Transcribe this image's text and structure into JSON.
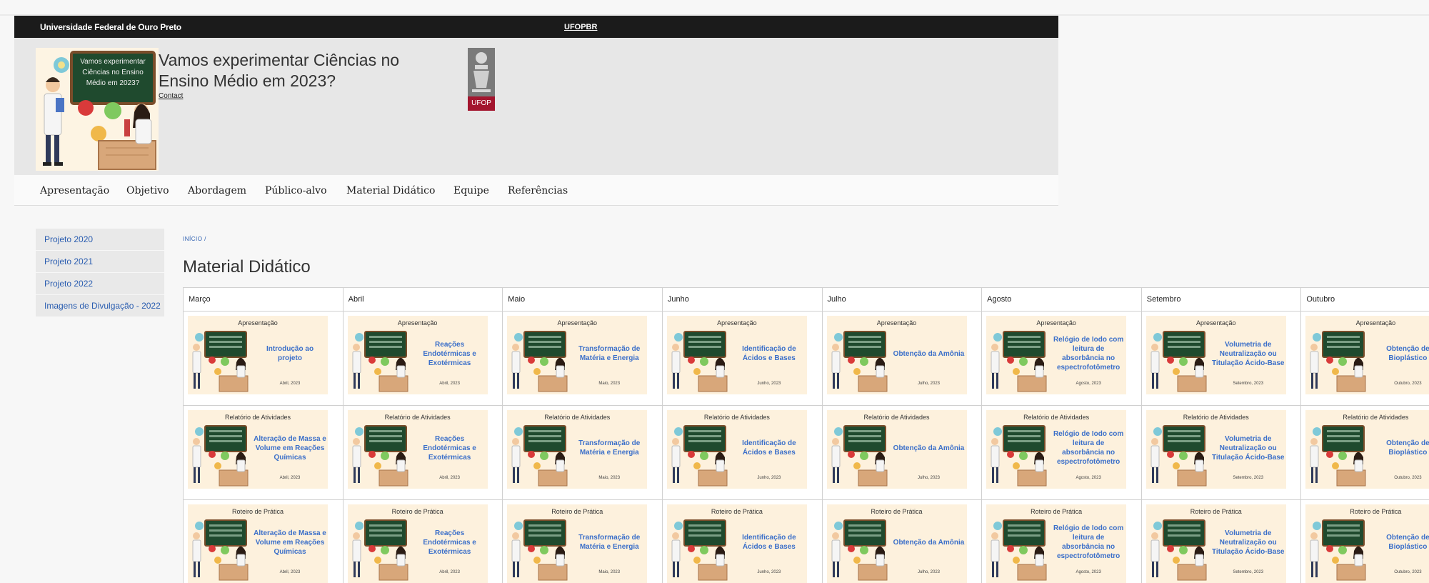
{
  "topbar": {
    "university": "Universidade Federal de Ouro Preto",
    "sigla": "UFOPBR"
  },
  "header": {
    "logo_text": "Vamos experimentar Ciências no Ensino Médio em 2023?",
    "title": "Vamos experimentar Ciências no Ensino Médio em 2023?",
    "contact": "Contact",
    "ufop_label": "UFOP",
    "colors": {
      "ufop_red": "#a3152e",
      "dark_bar": "#1b1b1b"
    }
  },
  "nav": {
    "items": [
      "Apresentação",
      "Objetivo",
      "Abordagem",
      "Público-alvo",
      "Material Didático",
      "Equipe",
      "Referências"
    ]
  },
  "sidebar": {
    "items": [
      "Projeto 2020",
      "Projeto 2021",
      "Projeto 2022",
      "Imagens de Divulgação - 2022"
    ]
  },
  "breadcrumb": "INÍCIO /",
  "page_title": "Material Didático",
  "table": {
    "months": [
      "Março",
      "Abril",
      "Maio",
      "Junho",
      "Julho",
      "Agosto",
      "Setembro",
      "Outubro"
    ],
    "rows": [
      {
        "label": "Apresentação",
        "topics": [
          "Introdução ao projeto",
          "Reações Endotérmicas e Exotérmicas",
          "Transformação de Matéria e Energia",
          "Identificação de Ácidos e Bases",
          "Obtenção da Amônia",
          "Relógio de Iodo com leitura de absorbância no espectrofotômetro",
          "Volumetria de Neutralização ou Titulação Ácido-Base",
          "Obtenção de Bioplástico"
        ],
        "dates": [
          "Abril, 2023",
          "Abril, 2023",
          "Maio, 2023",
          "Junho, 2023",
          "Julho, 2023",
          "Agosto, 2023",
          "Setembro, 2023",
          "Outubro, 2023"
        ]
      },
      {
        "label": "Relatório de Atividades",
        "topics": [
          "Alteração de Massa e Volume em Reações Químicas",
          "Reações Endotérmicas e Exotérmicas",
          "Transformação de Matéria e Energia",
          "Identificação de Ácidos e Bases",
          "Obtenção da Amônia",
          "Relógio de Iodo com leitura de absorbância no espectrofotômetro",
          "Volumetria de Neutralização ou Titulação Ácido-Base",
          "Obtenção de Bioplástico"
        ],
        "dates": [
          "Abril, 2023",
          "Abril, 2023",
          "Maio, 2023",
          "Junho, 2023",
          "Julho, 2023",
          "Agosto, 2023",
          "Setembro, 2023",
          "Outubro, 2023"
        ]
      },
      {
        "label": "Roteiro de Prática",
        "topics": [
          "Alteração de Massa e Volume em Reações Químicas",
          "Reações Endotérmicas e Exotérmicas",
          "Transformação de Matéria e Energia",
          "Identificação de Ácidos e Bases",
          "Obtenção da Amônia",
          "Relógio de Iodo com leitura de absorbância no espectrofotômetro",
          "Volumetria de Neutralização ou Titulação Ácido-Base",
          "Obtenção de Bioplástico"
        ],
        "dates": [
          "Abril, 2023",
          "Abril, 2023",
          "Maio, 2023",
          "Junho, 2023",
          "Julho, 2023",
          "Agosto, 2023",
          "Setembro, 2023",
          "Outubro, 2023"
        ]
      }
    ]
  }
}
